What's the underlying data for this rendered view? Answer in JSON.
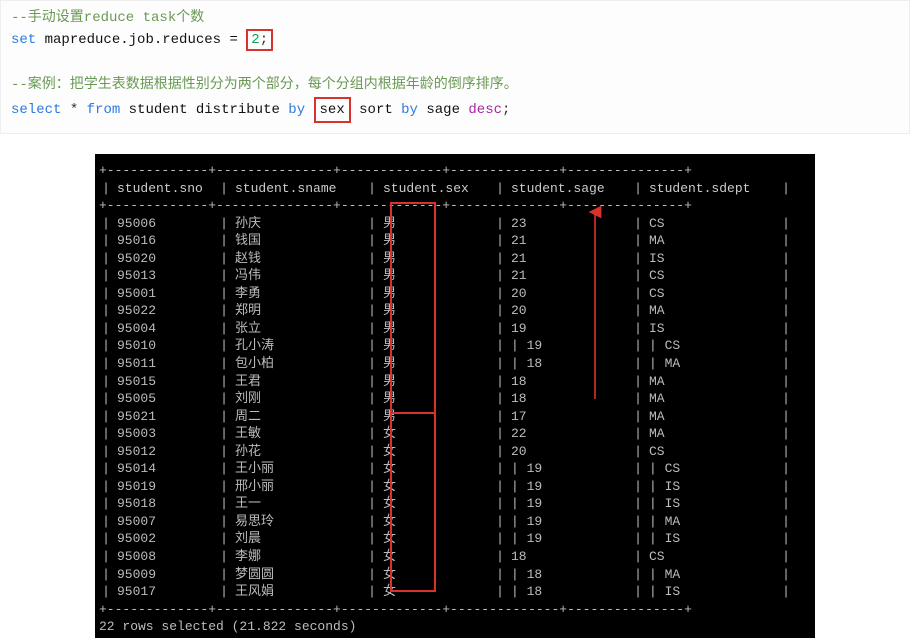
{
  "code": {
    "comment1": "--手动设置reduce task个数",
    "set_kw": "set",
    "set_prop": "mapreduce.job.reduces",
    "set_eq": "=",
    "set_val": "2",
    "set_semi": ";",
    "comment2": "--案例：把学生表数据根据性别分为两个部分，每个分组内根据年龄的倒序排序。",
    "q_select": "select",
    "q_star": "*",
    "q_from": "from",
    "q_tbl": "student",
    "q_distribute": "distribute",
    "q_by1": "by",
    "q_col1": "sex",
    "q_sort": "sort",
    "q_by2": "by",
    "q_col2": "sage",
    "q_desc": "desc",
    "q_semi": ";"
  },
  "terminal": {
    "sep": "+-------------+---------------+-------------+--------------+---------------+",
    "headers": {
      "sno": "student.sno",
      "sname": "student.sname",
      "sex": "student.sex",
      "sage": "student.sage",
      "sdept": "student.sdept"
    },
    "rows": [
      {
        "sno": "95006",
        "sname": "孙庆",
        "sex": "男",
        "sage": "23",
        "sdept": "CS",
        "sage_pipe": "",
        "sdept_pipe": ""
      },
      {
        "sno": "95016",
        "sname": "钱国",
        "sex": "男",
        "sage": "21",
        "sdept": "MA"
      },
      {
        "sno": "95020",
        "sname": "赵钱",
        "sex": "男",
        "sage": "21",
        "sdept": "IS"
      },
      {
        "sno": "95013",
        "sname": "冯伟",
        "sex": "男",
        "sage": "21",
        "sdept": "CS"
      },
      {
        "sno": "95001",
        "sname": "李勇",
        "sex": "男",
        "sage": "20",
        "sdept": "CS"
      },
      {
        "sno": "95022",
        "sname": "郑明",
        "sex": "男",
        "sage": "20",
        "sdept": "MA"
      },
      {
        "sno": "95004",
        "sname": "张立",
        "sex": "男",
        "sage": "19",
        "sdept": "IS"
      },
      {
        "sno": "95010",
        "sname": "孔小涛",
        "sex": "男",
        "sage": "| 19",
        "sdept": "| CS"
      },
      {
        "sno": "95011",
        "sname": "包小柏",
        "sex": "男",
        "sage": "| 18",
        "sdept": "| MA"
      },
      {
        "sno": "95015",
        "sname": "王君",
        "sex": "男",
        "sage": "18",
        "sdept": "MA"
      },
      {
        "sno": "95005",
        "sname": "刘刚",
        "sex": "男",
        "sage": "18",
        "sdept": "MA"
      },
      {
        "sno": "95021",
        "sname": "周二",
        "sex": "男",
        "sage": "17",
        "sdept": "MA"
      },
      {
        "sno": "95003",
        "sname": "王敏",
        "sex": "女",
        "sage": "22",
        "sdept": "MA"
      },
      {
        "sno": "95012",
        "sname": "孙花",
        "sex": "女",
        "sage": "20",
        "sdept": "CS"
      },
      {
        "sno": "95014",
        "sname": "王小丽",
        "sex": "女",
        "sage": "| 19",
        "sdept": "| CS"
      },
      {
        "sno": "95019",
        "sname": "邢小丽",
        "sex": "女",
        "sage": "| 19",
        "sdept": "| IS"
      },
      {
        "sno": "95018",
        "sname": "王一",
        "sex": "女",
        "sage": "| 19",
        "sdept": "| IS"
      },
      {
        "sno": "95007",
        "sname": "易思玲",
        "sex": "女",
        "sage": "| 19",
        "sdept": "| MA"
      },
      {
        "sno": "95002",
        "sname": "刘晨",
        "sex": "女",
        "sage": "| 19",
        "sdept": "| IS"
      },
      {
        "sno": "95008",
        "sname": "李娜",
        "sex": "女",
        "sage": "18",
        "sdept": "CS"
      },
      {
        "sno": "95009",
        "sname": "梦圆圆",
        "sex": "女",
        "sage": "| 18",
        "sdept": "| MA"
      },
      {
        "sno": "95017",
        "sname": "王风娟",
        "sex": "女",
        "sage": "| 18",
        "sdept": "| IS"
      }
    ],
    "footer": "22 rows selected (21.822 seconds)"
  }
}
